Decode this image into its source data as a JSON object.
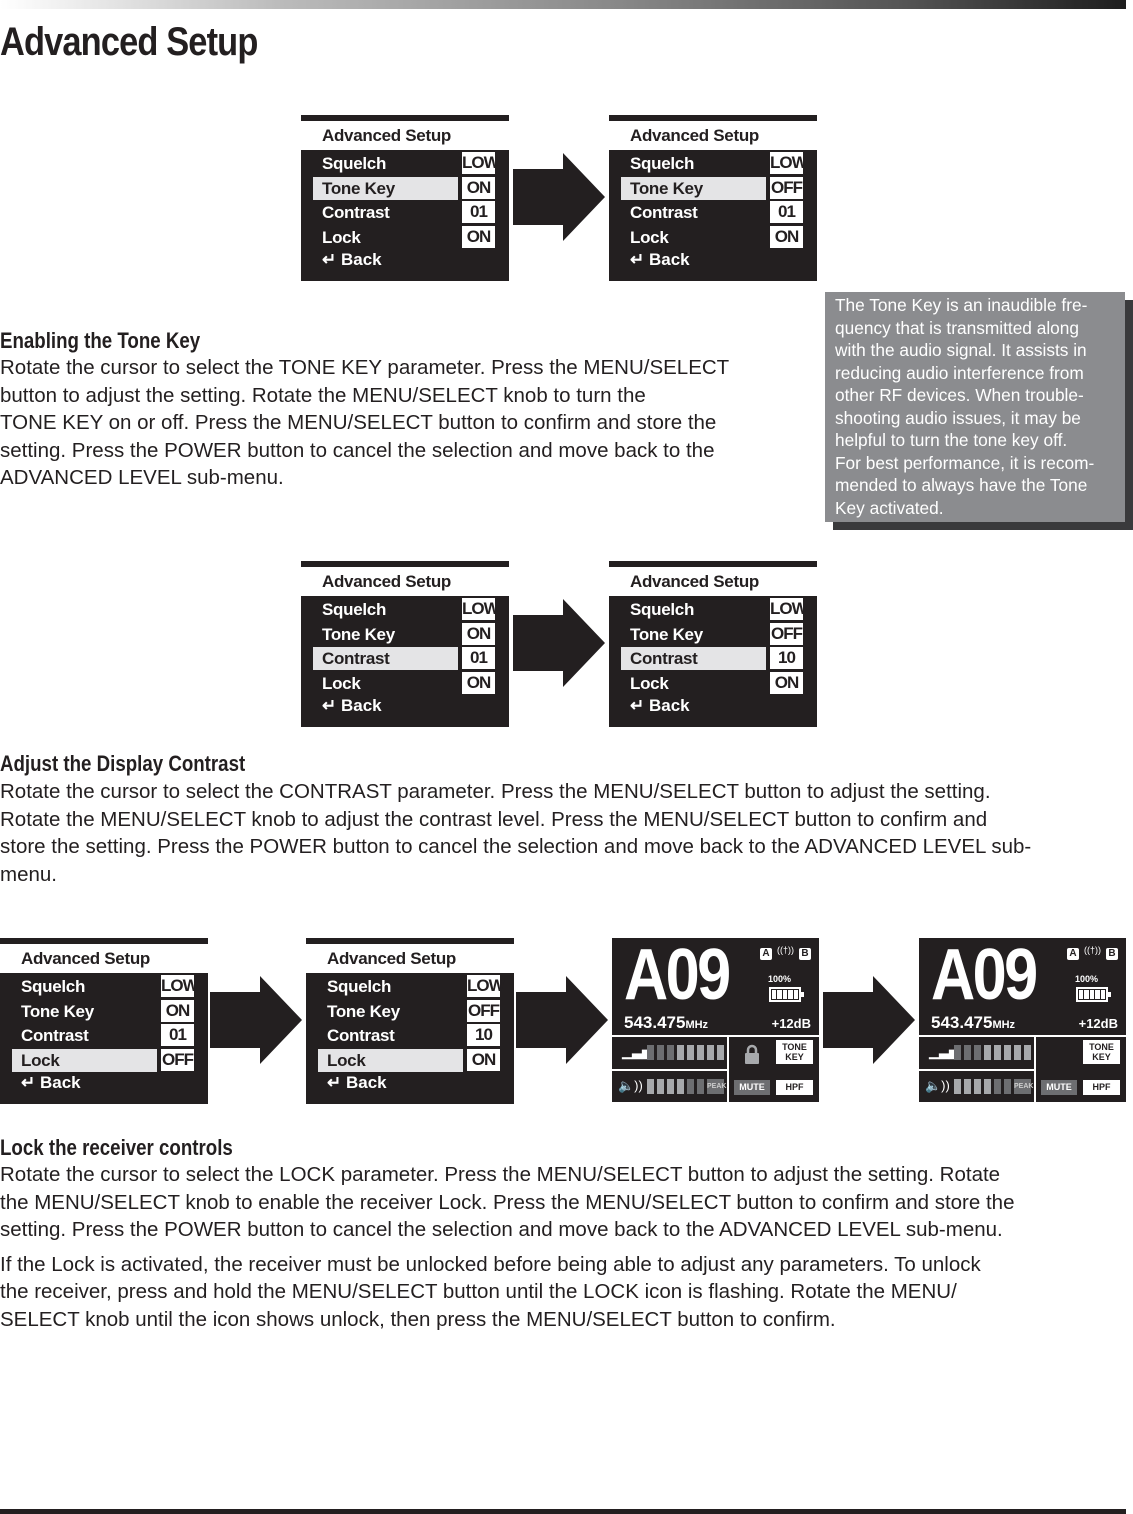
{
  "page_title": "Advanced Setup",
  "menu_title": "Advanced Setup",
  "back_label": "Back",
  "menu_labels": [
    "Squelch",
    "Tone Key",
    "Contrast",
    "Lock"
  ],
  "menus": [
    {
      "selected": 1,
      "values": [
        "LOW",
        "ON",
        "01",
        "ON"
      ]
    },
    {
      "selected": 1,
      "values": [
        "LOW",
        "OFF",
        "01",
        "ON"
      ]
    },
    {
      "selected": 2,
      "values": [
        "LOW",
        "ON",
        "01",
        "ON"
      ]
    },
    {
      "selected": 2,
      "values": [
        "LOW",
        "OFF",
        "10",
        "ON"
      ]
    },
    {
      "selected": 3,
      "values": [
        "LOW",
        "ON",
        "01",
        "OFF"
      ]
    },
    {
      "selected": 3,
      "values": [
        "LOW",
        "OFF",
        "10",
        "ON"
      ]
    }
  ],
  "displays": [
    {
      "channel": "A09",
      "freq": "543.475",
      "unit": "MHz",
      "gain": "+12dB",
      "battery": "100%",
      "locked": true,
      "tone_key": "TONE KEY",
      "mute": "MUTE",
      "hpf": "HPF",
      "peak": "PEAK"
    },
    {
      "channel": "A09",
      "freq": "543.475",
      "unit": "MHz",
      "gain": "+12dB",
      "battery": "100%",
      "locked": false,
      "tone_key": "TONE KEY",
      "mute": "MUTE",
      "hpf": "HPF",
      "peak": "PEAK"
    }
  ],
  "sections": {
    "tone_key": {
      "title": "Enabling the Tone Key",
      "lines": [
        "Rotate the cursor to select the TONE KEY parameter. Press the MENU/SELECT",
        "button to adjust the setting. Rotate the MENU/SELECT knob to turn the",
        "TONE KEY on or off. Press the MENU/SELECT button to confirm and store the",
        "setting. Press the POWER button to cancel the selection and move back to the",
        "ADVANCED LEVEL sub-menu."
      ]
    },
    "contrast": {
      "title": "Adjust the Display Contrast",
      "lines": [
        "Rotate the cursor to select the CONTRAST parameter. Press the MENU/SELECT button to adjust the setting.",
        "Rotate the MENU/SELECT knob to adjust the contrast level. Press the MENU/SELECT button to confirm and",
        "store the setting. Press the POWER button to cancel the selection and move back to the ADVANCED LEVEL sub-",
        "menu."
      ]
    },
    "lock": {
      "title": "Lock the receiver controls",
      "p1": [
        "Rotate the cursor to select the LOCK parameter. Press the MENU/SELECT button to adjust the setting. Rotate",
        "the MENU/SELECT knob to enable the receiver Lock. Press the MENU/SELECT button to confirm and store the",
        "setting. Press the POWER button to cancel the selection and move back to the ADVANCED LEVEL sub-menu."
      ],
      "p2": [
        "If the Lock is activated, the receiver must be unlocked before being able to adjust any parameters. To unlock",
        "the receiver, press and hold the MENU/SELECT button until the LOCK icon is flashing. Rotate the MENU/",
        "SELECT knob until the icon shows unlock, then press the MENU/SELECT button to confirm."
      ]
    }
  },
  "note": {
    "lines": [
      "The Tone Key is an inaudible fre-",
      "quency that is transmitted along",
      "with the audio signal. It assists in",
      "reducing audio interference from",
      "other RF devices. When trouble-",
      "shooting audio issues, it may be",
      "helpful to turn the tone key off.",
      "For best performance, it is recom-",
      "mended to always have the Tone",
      "Key activated."
    ]
  },
  "colors": {
    "lcd": "#231f20",
    "highlight": "#e4e4e6",
    "note_bg": "#8b8c8f"
  }
}
